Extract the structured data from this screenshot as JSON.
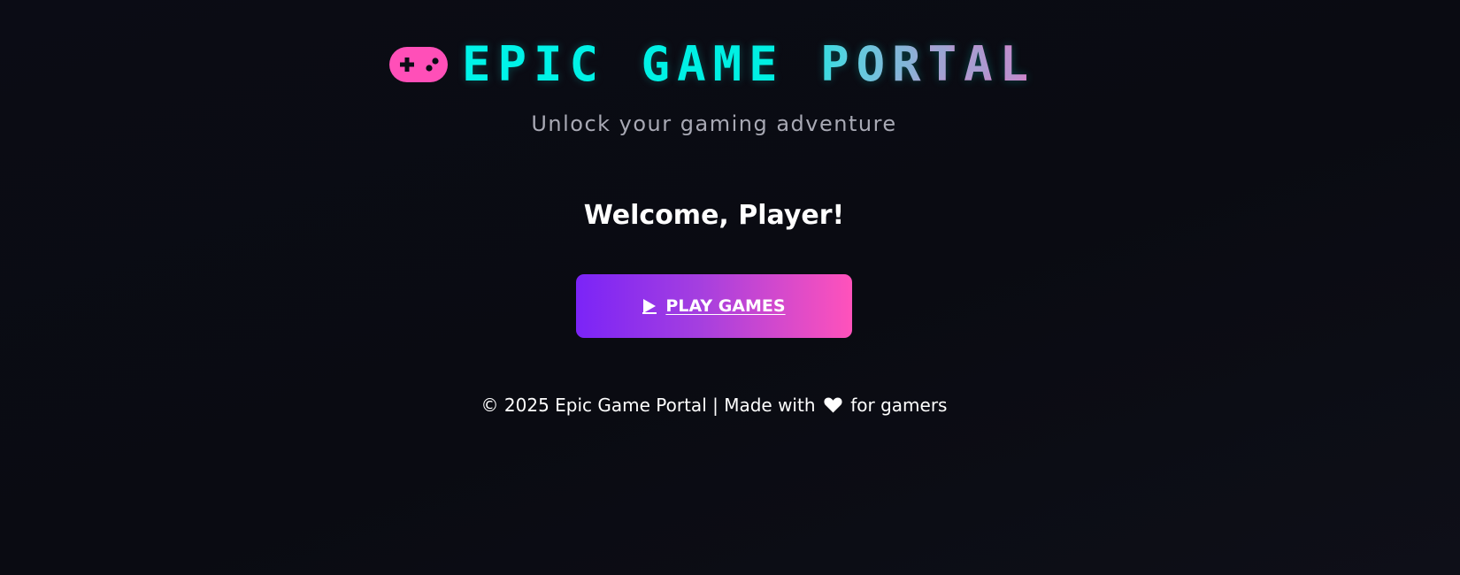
{
  "header": {
    "logo_icon": "gamepad-icon",
    "title": "EPIC GAME PORTAL",
    "subtitle": "Unlock your gaming adventure"
  },
  "main": {
    "welcome": "Welcome, Player!",
    "play_button": {
      "icon": "play-icon",
      "label": "PLAY GAMES"
    }
  },
  "footer": {
    "prefix": "© 2025 Epic Game Portal | Made with",
    "heart_icon": "heart-icon",
    "suffix": "for gamers"
  },
  "colors": {
    "background": "#0b0c15",
    "title_gradient_start": "#00f5ea",
    "title_gradient_end": "#e37bc9",
    "gamepad_pink": "#ff4fb8",
    "button_gradient_start": "#7b24f7",
    "button_gradient_end": "#ff52bb",
    "subtitle_gray": "#a8a9b4"
  }
}
